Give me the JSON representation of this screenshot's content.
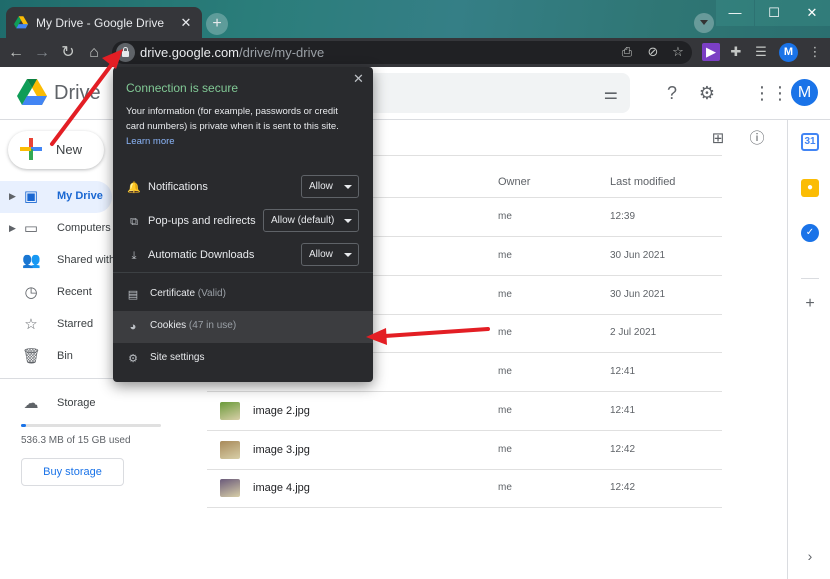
{
  "browser": {
    "tab_title": "My Drive - Google Drive",
    "tab_close": "✕",
    "new_tab": "+",
    "url_host": "drive.google.com",
    "url_path": "/drive/my-drive",
    "profile_initial": "M",
    "window_controls": {
      "minimize": "—",
      "maximize": "☐",
      "close": "✕"
    }
  },
  "app": {
    "logo_text": "Drive",
    "avatar_initial": "M",
    "new_button": "New"
  },
  "sidebar": {
    "items": [
      {
        "label": "My Drive",
        "icon": "my-drive-icon",
        "glyph": "▣",
        "has_caret": true,
        "active": true
      },
      {
        "label": "Computers",
        "icon": "computers-icon",
        "glyph": "▭",
        "has_caret": true,
        "active": false
      },
      {
        "label": "Shared with",
        "icon": "shared-icon",
        "glyph": "👥",
        "has_caret": false,
        "active": false
      },
      {
        "label": "Recent",
        "icon": "clock-icon",
        "glyph": "◷",
        "has_caret": false,
        "active": false
      },
      {
        "label": "Starred",
        "icon": "star-icon",
        "glyph": "☆",
        "has_caret": false,
        "active": false
      },
      {
        "label": "Bin",
        "icon": "bin-icon",
        "glyph": "🗑",
        "has_caret": false,
        "active": false
      }
    ],
    "storage_label": "Storage",
    "storage_text": "536.3 MB of 15 GB used",
    "storage_fraction": 0.035,
    "buy_storage": "Buy storage"
  },
  "table": {
    "owner_header": "Owner",
    "modified_header": "Last modified",
    "rows": [
      {
        "name": "",
        "owner": "me",
        "modified": "12:39"
      },
      {
        "name": "",
        "owner": "me",
        "modified": "30 Jun 2021"
      },
      {
        "name": "",
        "owner": "me",
        "modified": "30 Jun 2021"
      },
      {
        "name": "",
        "owner": "me",
        "modified": "2 Jul 2021"
      },
      {
        "name": "",
        "owner": "me",
        "modified": "12:41"
      },
      {
        "name": "image 2.jpg",
        "owner": "me",
        "modified": "12:41"
      },
      {
        "name": "image 3.jpg",
        "owner": "me",
        "modified": "12:42"
      },
      {
        "name": "image 4.jpg",
        "owner": "me",
        "modified": "12:42"
      }
    ]
  },
  "popup": {
    "title": "Connection is secure",
    "close": "✕",
    "description": "Your information (for example, passwords or credit card numbers) is private when it is sent to this site.",
    "learn_more": "Learn more",
    "permissions": [
      {
        "label": "Notifications",
        "value": "Allow",
        "icon": "bell-icon",
        "glyph": "🔔"
      },
      {
        "label": "Pop-ups and redirects",
        "value": "Allow (default)",
        "icon": "popup-icon",
        "glyph": "⧉"
      },
      {
        "label": "Automatic Downloads",
        "value": "Allow",
        "icon": "download-icon",
        "glyph": "⤓"
      }
    ],
    "items": [
      {
        "label": "Certificate",
        "sub": "(Valid)",
        "icon": "certificate-icon",
        "glyph": "▤"
      },
      {
        "label": "Cookies",
        "sub": "(47 in use)",
        "icon": "cookie-icon",
        "glyph": "◕"
      },
      {
        "label": "Site settings",
        "sub": "",
        "icon": "gear-icon",
        "glyph": "⚙"
      }
    ]
  },
  "colors": {
    "accent": "#1a73e8",
    "secure_green": "#81c995",
    "arrow_red": "#e31e24"
  }
}
